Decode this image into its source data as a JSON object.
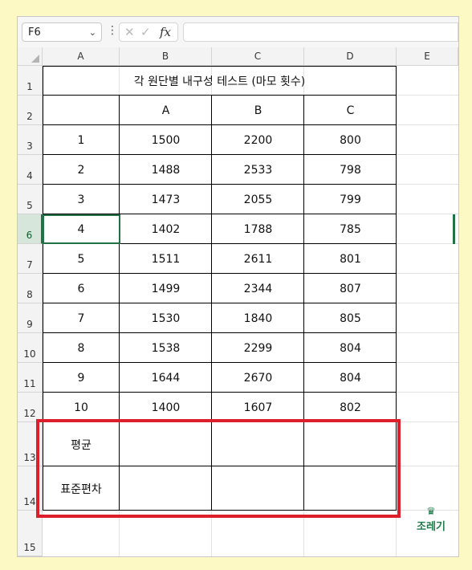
{
  "name_box": "F6",
  "formula_bar": {
    "cancel_glyph": "✕",
    "enter_glyph": "✓",
    "fx_label": "fx",
    "more_glyph": "⋮",
    "value": ""
  },
  "columns": [
    "A",
    "B",
    "C",
    "D",
    "E"
  ],
  "rows": [
    "1",
    "2",
    "3",
    "4",
    "5",
    "6",
    "7",
    "8",
    "9",
    "10",
    "11",
    "12",
    "13",
    "14",
    "15"
  ],
  "selected_row": "6",
  "table": {
    "title": "각 원단별 내구성 테스트 (마모 횟수)",
    "headers": [
      "",
      "A",
      "B",
      "C"
    ],
    "data": [
      [
        "1",
        "1500",
        "2200",
        "800"
      ],
      [
        "2",
        "1488",
        "2533",
        "798"
      ],
      [
        "3",
        "1473",
        "2055",
        "799"
      ],
      [
        "4",
        "1402",
        "1788",
        "785"
      ],
      [
        "5",
        "1511",
        "2611",
        "801"
      ],
      [
        "6",
        "1499",
        "2344",
        "807"
      ],
      [
        "7",
        "1530",
        "1840",
        "805"
      ],
      [
        "8",
        "1538",
        "2299",
        "804"
      ],
      [
        "9",
        "1644",
        "2670",
        "804"
      ],
      [
        "10",
        "1400",
        "1607",
        "802"
      ]
    ],
    "summary": [
      [
        "평균",
        "",
        "",
        ""
      ],
      [
        "표준편차",
        "",
        "",
        ""
      ]
    ]
  },
  "highlight_color": "#dc1f2b",
  "watermark": {
    "text": "조레기",
    "icon": "crown-icon"
  }
}
